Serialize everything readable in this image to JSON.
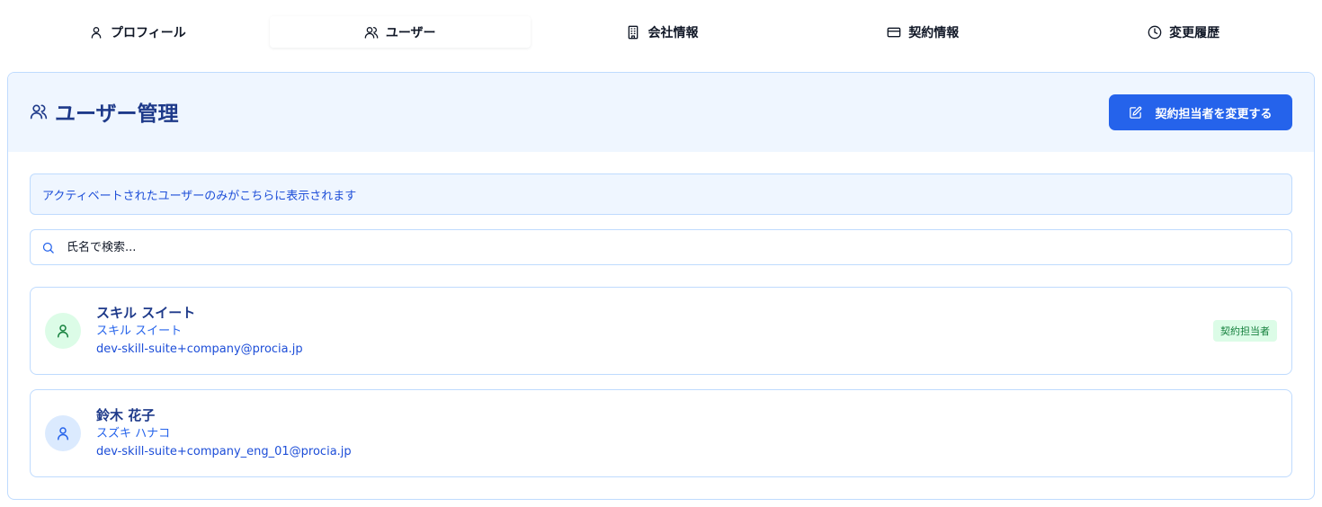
{
  "tabs": [
    {
      "label": "プロフィール",
      "icon": "user-icon"
    },
    {
      "label": "ユーザー",
      "icon": "users-icon",
      "active": true
    },
    {
      "label": "会社情報",
      "icon": "building-icon"
    },
    {
      "label": "契約情報",
      "icon": "credit-card-icon"
    },
    {
      "label": "変更履歴",
      "icon": "clock-icon"
    }
  ],
  "card": {
    "title": "ユーザー管理",
    "title_icon": "users-icon",
    "change_button_label": "契約担当者を変更する",
    "change_button_icon": "edit-icon"
  },
  "notice": "アクティベートされたユーザーのみがこちらに表示されます",
  "search": {
    "placeholder": "氏名で検索...",
    "value": "",
    "icon": "search-icon"
  },
  "users": [
    {
      "name": "スキル スイート",
      "kana": "スキル スイート",
      "email": "dev-skill-suite+company@procia.jp",
      "badge": "契約担当者",
      "avatar_color": "#15803d"
    },
    {
      "name": "鈴木 花子",
      "kana": "スズキ ハナコ",
      "email": "dev-skill-suite+company_eng_01@procia.jp",
      "badge": "",
      "avatar_color": "#2563eb"
    }
  ],
  "colors": {
    "primary": "#2563eb",
    "heading": "#1e3a8a",
    "header_bg": "#eff6ff",
    "border": "#bfdbfe",
    "badge_bg": "#dcfce7",
    "badge_text": "#15803d"
  }
}
